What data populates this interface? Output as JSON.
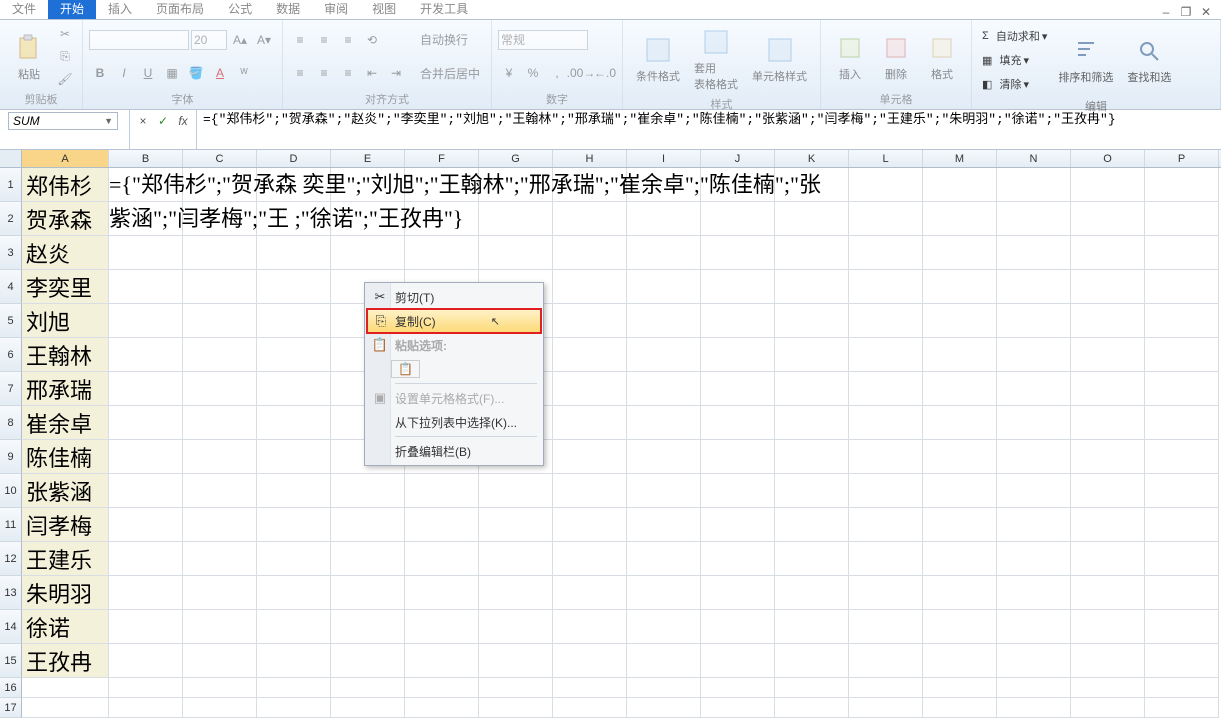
{
  "tabs": {
    "active": "开始",
    "others": [
      "文件",
      "插入",
      "页面布局",
      "公式",
      "数据",
      "审阅",
      "视图",
      "开发工具"
    ]
  },
  "ribbon": {
    "clipboard": {
      "paste": "粘贴",
      "label": "剪贴板"
    },
    "font": {
      "label": "字体",
      "size": "20",
      "bold": "B",
      "italic": "I",
      "underline": "U"
    },
    "align": {
      "label": "对齐方式",
      "wrap": "自动换行",
      "merge": "合并后居中"
    },
    "number": {
      "label": "数字",
      "format_sel": "常规"
    },
    "styles": {
      "label": "样式",
      "cond": "条件格式",
      "table": "套用\n表格格式",
      "cell": "单元格样式"
    },
    "cells": {
      "label": "单元格",
      "insert": "插入",
      "delete": "删除",
      "format": "格式"
    },
    "edit": {
      "label": "编辑",
      "autosum": "自动求和",
      "fill": "填充",
      "clear": "清除",
      "sort": "排序和筛选",
      "find": "查找和选"
    }
  },
  "formula_bar": {
    "name": "SUM",
    "cancel": "×",
    "enter": "✓",
    "fx": "fx",
    "formula": "={\"郑伟杉\";\"贺承森\";\"赵炎\";\"李奕里\";\"刘旭\";\"王翰林\";\"邢承瑞\";\"崔余卓\";\"陈佳楠\";\"张紫涵\";\"闫孝梅\";\"王建乐\";\"朱明羽\";\"徐诺\";\"王孜冉\"}"
  },
  "columns": [
    "A",
    "B",
    "C",
    "D",
    "E",
    "F",
    "G",
    "H",
    "I",
    "J",
    "K",
    "L",
    "M",
    "N",
    "O",
    "P"
  ],
  "names": [
    "郑伟杉",
    "贺承森",
    "赵炎",
    "李奕里",
    "刘旭",
    "王翰林",
    "邢承瑞",
    "崔余卓",
    "陈佳楠",
    "张紫涵",
    "闫孝梅",
    "王建乐",
    "朱明羽",
    "徐诺",
    "王孜冉"
  ],
  "cell_overflow": {
    "line1": "={\"郑伟杉\";\"贺承森            奕里\";\"刘旭\";\"王翰林\";\"邢承瑞\";\"崔余卓\";\"陈佳楠\";\"张",
    "line2": "紫涵\";\"闫孝梅\";\"王           ;\"徐诺\";\"王孜冉\"}"
  },
  "context": {
    "cut": "剪切(T)",
    "copy": "复制(C)",
    "paste_opt": "粘贴选项:",
    "format_cells": "设置单元格格式(F)...",
    "pick_list": "从下拉列表中选择(K)...",
    "collapse": "折叠编辑栏(B)"
  }
}
